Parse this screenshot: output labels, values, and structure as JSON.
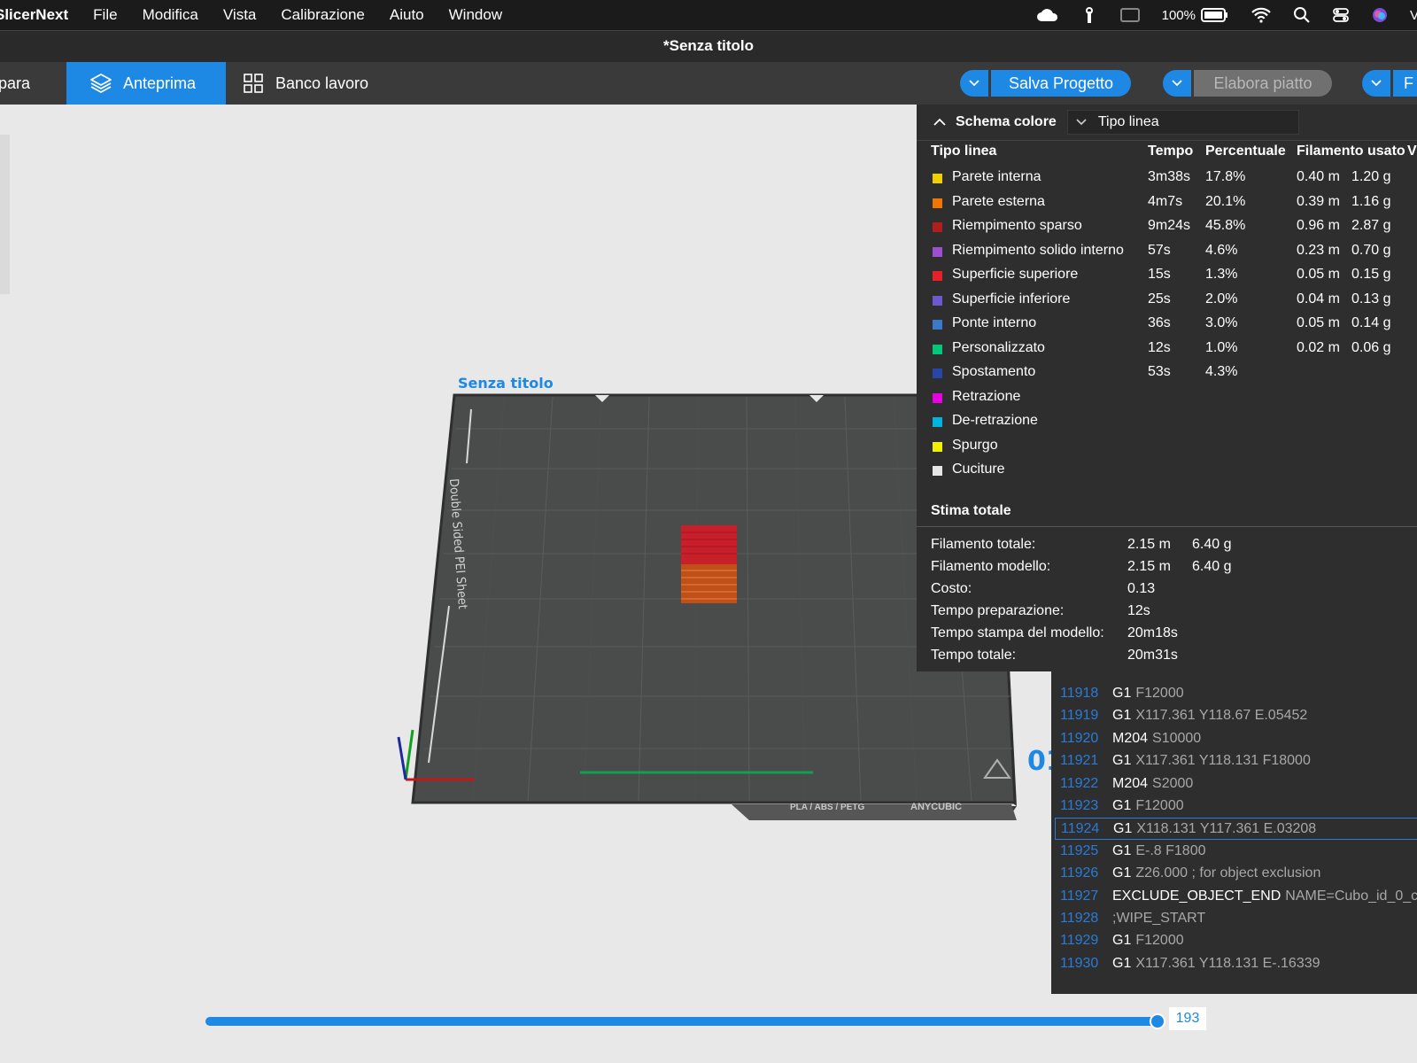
{
  "menubar": {
    "app_name": "SlicerNext",
    "items": [
      "File",
      "Modifica",
      "Vista",
      "Calibrazione",
      "Aiuto",
      "Window"
    ],
    "battery_text": "100%",
    "icons": [
      "creative-cloud-icon",
      "cellular-icon",
      "display-icon",
      "battery-icon",
      "wifi-icon",
      "spotlight-search-icon",
      "control-center-icon",
      "siri-icon"
    ],
    "trailing_text": "V"
  },
  "window": {
    "title": "*Senza titolo"
  },
  "toolbar": {
    "prepare_label": "para",
    "preview_label": "Anteprima",
    "workbench_label": "Banco lavoro",
    "save_label": "Salva Progetto",
    "slice_label": "Elabora piatto",
    "print_label": "F"
  },
  "legend": {
    "title": "Schema colore",
    "scheme": "Tipo linea",
    "headers": {
      "type": "Tipo linea",
      "time": "Tempo",
      "percent": "Percentuale",
      "filament": "Filamento usato",
      "display": "V"
    },
    "rows": [
      {
        "color": "#f0d000",
        "label": "Parete interna",
        "time": "3m38s",
        "percent": "17.8%",
        "length": "0.40 m",
        "weight": "1.20 g"
      },
      {
        "color": "#f07800",
        "label": "Parete esterna",
        "time": "4m7s",
        "percent": "20.1%",
        "length": "0.39 m",
        "weight": "1.16 g"
      },
      {
        "color": "#b01e1e",
        "label": "Riempimento sparso",
        "time": "9m24s",
        "percent": "45.8%",
        "length": "0.96 m",
        "weight": "2.87 g"
      },
      {
        "color": "#9d4fcf",
        "label": "Riempimento solido interno",
        "time": "57s",
        "percent": "4.6%",
        "length": "0.23 m",
        "weight": "0.70 g"
      },
      {
        "color": "#e8202a",
        "label": "Superficie superiore",
        "time": "15s",
        "percent": "1.3%",
        "length": "0.05 m",
        "weight": "0.15 g"
      },
      {
        "color": "#6a5acd",
        "label": "Superficie inferiore",
        "time": "25s",
        "percent": "2.0%",
        "length": "0.04 m",
        "weight": "0.13 g"
      },
      {
        "color": "#3c78c8",
        "label": "Ponte interno",
        "time": "36s",
        "percent": "3.0%",
        "length": "0.05 m",
        "weight": "0.14 g"
      },
      {
        "color": "#00c878",
        "label": "Personalizzato",
        "time": "12s",
        "percent": "1.0%",
        "length": "0.02 m",
        "weight": "0.06 g"
      },
      {
        "color": "#2846a8",
        "label": "Spostamento",
        "time": "53s",
        "percent": "4.3%",
        "length": "",
        "weight": ""
      },
      {
        "color": "#e800e0",
        "label": "Retrazione",
        "time": "",
        "percent": "",
        "length": "",
        "weight": ""
      },
      {
        "color": "#00b4e0",
        "label": "De-retrazione",
        "time": "",
        "percent": "",
        "length": "",
        "weight": ""
      },
      {
        "color": "#f0f000",
        "label": "Spurgo",
        "time": "",
        "percent": "",
        "length": "",
        "weight": ""
      },
      {
        "color": "#e6e6e6",
        "label": "Cuciture",
        "time": "",
        "percent": "",
        "length": "",
        "weight": ""
      }
    ],
    "totals_title": "Stima totale",
    "totals": [
      {
        "label": "Filamento totale:",
        "v1": "2.15 m",
        "v2": "6.40 g"
      },
      {
        "label": "Filamento modello:",
        "v1": "2.15 m",
        "v2": "6.40 g"
      },
      {
        "label": "Costo:",
        "v1": "0.13",
        "v2": ""
      },
      {
        "label": "Tempo preparazione:",
        "v1": "12s",
        "v2": ""
      },
      {
        "label": "Tempo stampa del modello:",
        "v1": "20m18s",
        "v2": ""
      },
      {
        "label": "Tempo totale:",
        "v1": "20m31s",
        "v2": ""
      }
    ]
  },
  "gcode": {
    "lines": [
      {
        "num": "11918",
        "cmd": "G1",
        "params": "F12000"
      },
      {
        "num": "11919",
        "cmd": "G1",
        "params": "X117.361 Y118.67 E.05452"
      },
      {
        "num": "11920",
        "cmd": "M204",
        "params": "S10000"
      },
      {
        "num": "11921",
        "cmd": "G1",
        "params": "X117.361 Y118.131 F18000"
      },
      {
        "num": "11922",
        "cmd": "M204",
        "params": "S2000"
      },
      {
        "num": "11923",
        "cmd": "G1",
        "params": "F12000"
      },
      {
        "num": "11924",
        "cmd": "G1",
        "params": "X118.131 Y117.361 E.03208",
        "selected": true
      },
      {
        "num": "11925",
        "cmd": "G1",
        "params": "E-.8 F1800"
      },
      {
        "num": "11926",
        "cmd": "G1",
        "params": "Z26.000 ; for object exclusion"
      },
      {
        "num": "11927",
        "cmd": "EXCLUDE_OBJECT_END",
        "params": "NAME=Cubo_id_0_c"
      },
      {
        "num": "11928",
        "cmd": "",
        "params": ";WIPE_START"
      },
      {
        "num": "11929",
        "cmd": "G1",
        "params": "F12000"
      },
      {
        "num": "11930",
        "cmd": "G1",
        "params": "X117.361 Y118.131 E-.16339"
      }
    ]
  },
  "plate": {
    "name": "Senza titolo",
    "sheet_label": "Double Sided PEI Sheet",
    "material_label": "PLA / ABS / PETG",
    "brand_label": "ANYCUBIC",
    "plate_number": "01"
  },
  "slider": {
    "value": "193",
    "fraction": 0.99
  },
  "colors": {
    "accent": "#1e88e5",
    "panel": "#2e2e2e",
    "toolbar": "#3a3a3a",
    "viewport": "#e8e8e8"
  }
}
